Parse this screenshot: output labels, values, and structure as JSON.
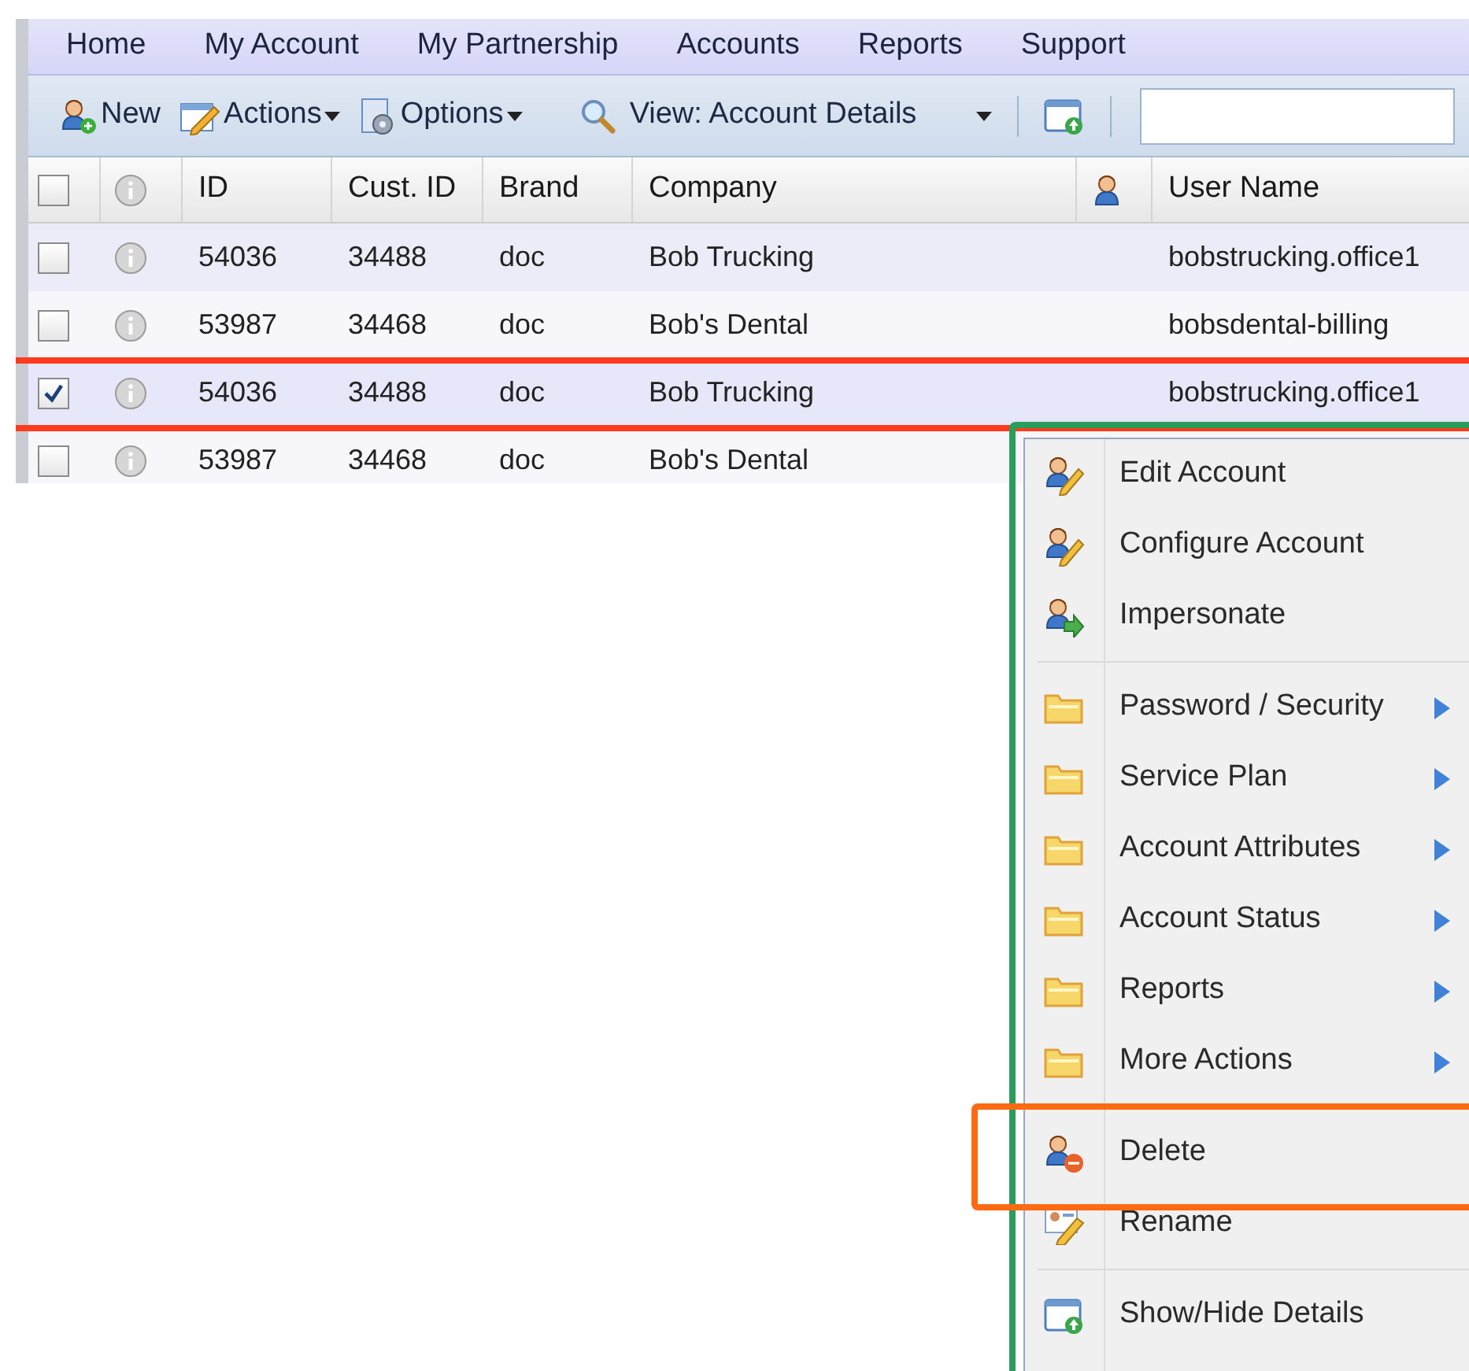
{
  "menu_bar": [
    {
      "label": "Home"
    },
    {
      "label": "My Account"
    },
    {
      "label": "My Partnership"
    },
    {
      "label": "Accounts"
    },
    {
      "label": "Reports"
    },
    {
      "label": "Support"
    }
  ],
  "toolbar": {
    "new": "New",
    "actions": "Actions",
    "options": "Options",
    "view": "View: Account Details"
  },
  "table": {
    "all_checked": false,
    "columns": [
      "ID",
      "Cust. ID",
      "Brand",
      "Company",
      "User Name"
    ],
    "rows": [
      {
        "checked": false,
        "cells": [
          "54036",
          "34488",
          "doc",
          "Bob Trucking",
          "bobstrucking.office1"
        ]
      },
      {
        "checked": false,
        "cells": [
          "53987",
          "34468",
          "doc",
          "Bob's Dental",
          "bobsdental-billing"
        ]
      },
      {
        "checked": true,
        "cells": [
          "54036",
          "34488",
          "doc",
          "Bob Trucking",
          "bobstrucking.office1"
        ]
      },
      {
        "checked": false,
        "cells": [
          "53987",
          "34468",
          "doc",
          "Bob's Dental"
        ]
      }
    ]
  },
  "context_menu": {
    "groups": [
      [
        {
          "label": "Edit Account",
          "submenu": false
        },
        {
          "label": "Configure Account",
          "submenu": false
        },
        {
          "label": "Impersonate",
          "submenu": false
        }
      ],
      [
        {
          "label": "Password / Security",
          "submenu": true
        },
        {
          "label": "Service Plan",
          "submenu": true
        },
        {
          "label": "Account Attributes",
          "submenu": true
        },
        {
          "label": "Account Status",
          "submenu": true
        },
        {
          "label": "Reports",
          "submenu": true
        },
        {
          "label": "More Actions",
          "submenu": true
        }
      ],
      [
        {
          "label": "Delete",
          "submenu": false
        },
        {
          "label": "Rename",
          "submenu": false
        }
      ],
      [
        {
          "label": "Show/Hide Details",
          "submenu": false
        }
      ]
    ]
  },
  "annotations": [
    {
      "kind": "line",
      "color": "#ff3b1f"
    },
    {
      "kind": "line",
      "color": "#ff3b1f"
    },
    {
      "kind": "box",
      "color": "#2a9d5c"
    },
    {
      "kind": "box",
      "color": "#ff6a13"
    }
  ]
}
